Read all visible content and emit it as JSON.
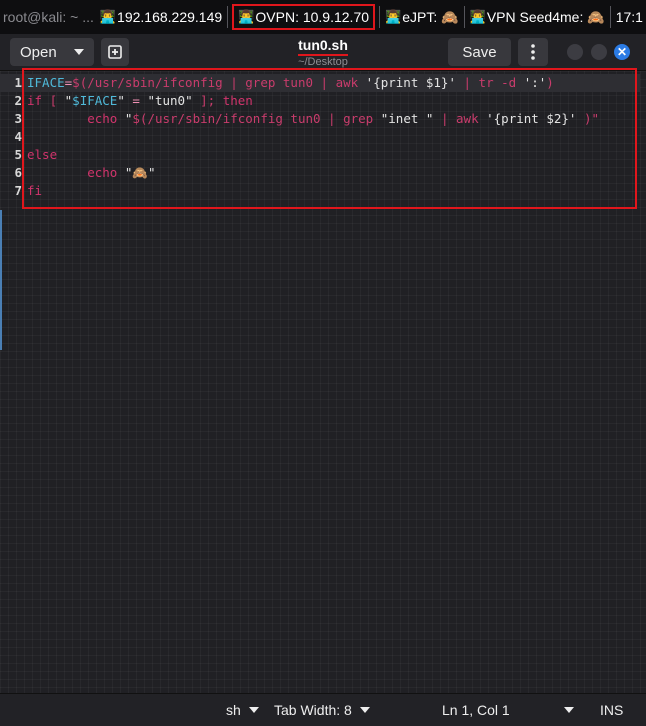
{
  "panel": {
    "terminal": "root@kali: ~ ...",
    "ip": "192.168.229.149",
    "ovpn": "OVPN: 10.9.12.70",
    "ejpt": "eJPT: 🙈",
    "vpn_seed": "VPN Seed4me: 🙈",
    "clock": "17:1",
    "hacker_emoji": "👨‍💻"
  },
  "header": {
    "open_label": "Open",
    "title": "tun0.sh",
    "subtitle": "~/Desktop",
    "save_label": "Save"
  },
  "editor": {
    "lines": [
      {
        "n": "1",
        "segments": [
          {
            "t": "IFACE",
            "c": "var"
          },
          {
            "t": "=",
            "c": "op"
          },
          {
            "t": "$(/usr/sbin/ifconfig | grep tun0 | awk ",
            "c": "sub"
          },
          {
            "t": "'{print $1}'",
            "c": "str"
          },
          {
            "t": " | tr -d ",
            "c": "sub"
          },
          {
            "t": "':'",
            "c": "str"
          },
          {
            "t": ")",
            "c": "sub"
          }
        ]
      },
      {
        "n": "2",
        "segments": [
          {
            "t": "if",
            "c": "kw"
          },
          {
            "t": " [ ",
            "c": "sub"
          },
          {
            "t": "\"",
            "c": "str"
          },
          {
            "t": "$IFACE",
            "c": "var"
          },
          {
            "t": "\"",
            "c": "str"
          },
          {
            "t": " = ",
            "c": "op"
          },
          {
            "t": "\"tun0\"",
            "c": "str"
          },
          {
            "t": " ]; ",
            "c": "sub"
          },
          {
            "t": "then",
            "c": "kw"
          }
        ]
      },
      {
        "n": "3",
        "segments": [
          {
            "t": "        ",
            "c": "str"
          },
          {
            "t": "echo",
            "c": "kw"
          },
          {
            "t": " \"",
            "c": "str"
          },
          {
            "t": "$(/usr/sbin/ifconfig tun0 | grep ",
            "c": "sub"
          },
          {
            "t": "\"inet \"",
            "c": "str"
          },
          {
            "t": " | awk ",
            "c": "sub"
          },
          {
            "t": "'{print $2}'",
            "c": "str"
          },
          {
            "t": " )\"",
            "c": "sub"
          }
        ]
      },
      {
        "n": "4",
        "segments": []
      },
      {
        "n": "5",
        "segments": [
          {
            "t": "else",
            "c": "kw"
          }
        ]
      },
      {
        "n": "6",
        "segments": [
          {
            "t": "        ",
            "c": "str"
          },
          {
            "t": "echo",
            "c": "kw"
          },
          {
            "t": " \"🙈\"",
            "c": "str"
          }
        ]
      },
      {
        "n": "7",
        "segments": [
          {
            "t": "fi",
            "c": "kw"
          }
        ]
      }
    ]
  },
  "statusbar": {
    "language": "sh",
    "tab_width": "Tab Width: 8",
    "position": "Ln 1, Col 1",
    "mode": "INS"
  },
  "colors": {
    "accent": "#2b7be4",
    "highlight_red": "#e0161c",
    "keyword": "#d1346c",
    "variable": "#4fb9d9"
  }
}
